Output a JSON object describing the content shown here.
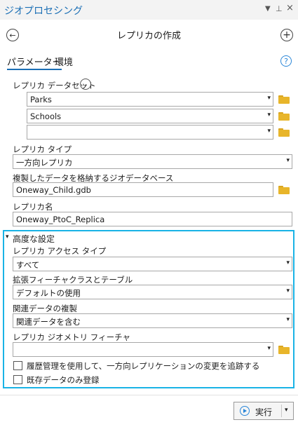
{
  "window": {
    "title": "ジオプロセシング",
    "controls": [
      "▾",
      "ᵖ",
      "×"
    ]
  },
  "header": {
    "title": "レプリカの作成"
  },
  "tabs": [
    {
      "label": "パラメーター",
      "active": true
    },
    {
      "label": "環境",
      "active": false
    }
  ],
  "params": {
    "replica_datasets_label": "レプリカ データセット",
    "datasets": [
      "Parks",
      "Schools",
      ""
    ],
    "replica_type_label": "レプリカ タイプ",
    "replica_type_value": "一方向レプリカ",
    "geodatabase_label": "複製したデータを格納するジオデータベース",
    "geodatabase_value": "Oneway_Child.gdb",
    "replica_name_label": "レプリカ名",
    "replica_name_value": "Oneway_PtoC_Replica"
  },
  "advanced": {
    "header": "高度な設定",
    "access_type_label": "レプリカ アクセス タイプ",
    "access_type_value": "すべて",
    "ext_label": "拡張フィーチャクラスとテーブル",
    "ext_value": "デフォルトの使用",
    "related_label": "関連データの複製",
    "related_value": "関連データを含む",
    "geometry_label": "レプリカ ジオメトリ フィーチャ",
    "geometry_value": "",
    "check_history": "履歴管理を使用して、一方向レプリケーションの変更を追跡する",
    "check_existing": "既存データのみ登録"
  },
  "footer": {
    "run_label": "実行"
  },
  "colors": {
    "accent": "#1b6fb5",
    "highlight_border": "#19b3e6",
    "folder": "#e8b52a"
  }
}
